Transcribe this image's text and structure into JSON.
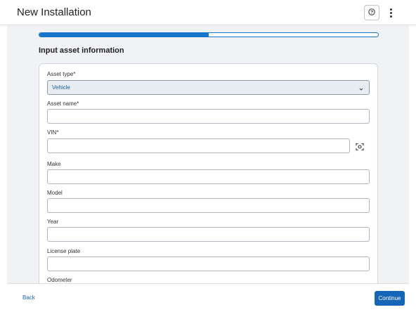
{
  "header": {
    "title": "New Installation",
    "help_icon": "help-circle-icon",
    "more_icon": "more-vertical-icon"
  },
  "progress": {
    "value": 0.5
  },
  "form": {
    "section_title": "Input asset information",
    "fields": {
      "asset_type": {
        "label": "Asset type*",
        "value": "Vehicle"
      },
      "asset_name": {
        "label": "Asset name*",
        "value": ""
      },
      "vin": {
        "label": "VIN*",
        "value": "",
        "scan_icon": "scan-icon"
      },
      "make": {
        "label": "Make",
        "value": ""
      },
      "model": {
        "label": "Model",
        "value": ""
      },
      "year": {
        "label": "Year",
        "value": ""
      },
      "license_plate": {
        "label": "License plate",
        "value": ""
      },
      "odometer": {
        "label": "Odometer"
      }
    }
  },
  "footer": {
    "back_label": "Back",
    "continue_label": "Continue"
  },
  "colors": {
    "primary": "#1566b8",
    "progress": "#1577c9",
    "background": "#f0f2f5"
  }
}
